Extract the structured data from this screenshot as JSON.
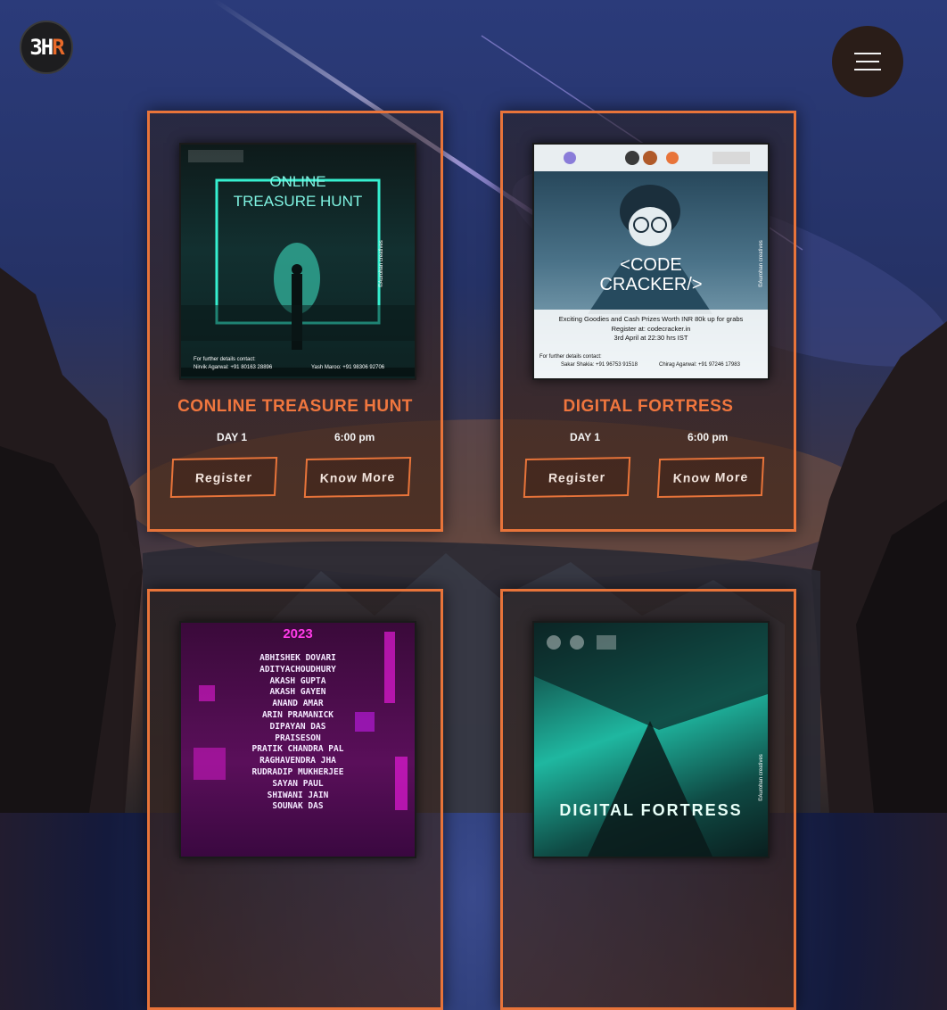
{
  "header": {
    "logo_text_a": "3H",
    "logo_text_b": "R"
  },
  "events": [
    {
      "title": "CONLINE TREASURE HUNT",
      "day": "DAY 1",
      "time": "6:00 pm",
      "register_label": "Register",
      "know_more_label": "Know More",
      "poster": {
        "line1": "ONLINE",
        "line2": "TREASURE HUNT",
        "contact_heading": "For further details contact:",
        "contact_a": "Nirvik Agarwal: +91 80163 28896",
        "contact_b": "Yash Maroo: +91 98306 92706",
        "credit": "©Aurohan creatives"
      }
    },
    {
      "title": "DIGITAL FORTRESS",
      "day": "DAY 1",
      "time": "6:00 pm",
      "register_label": "Register",
      "know_more_label": "Know More",
      "poster": {
        "line1": "<CODE",
        "line2": "CRACKER/>",
        "prize": "Exciting Goodies and Cash Prizes Worth INR 80k up for grabs",
        "register": "Register at: codecracker.in",
        "date": "3rd April at 22:30 hrs IST",
        "contact_heading": "For further details contact:",
        "contact_a": "Sakar Shakia: +91 96753 91518",
        "contact_b": "Chirag Agarwal: +91 97246 17983",
        "credit": "©Aurohan creatives"
      }
    },
    {
      "poster": {
        "year": "2023",
        "names": [
          "ABHISHEK DOVARI",
          "ADITYACHOUDHURY",
          "AKASH GUPTA",
          "AKASH GAYEN",
          "ANAND AMAR",
          "ARIN PRAMANICK",
          "DIPAYAN DAS",
          "PRAISESON",
          "PRATIK CHANDRA PAL",
          "RAGHAVENDRA JHA",
          "RUDRADIP MUKHERJEE",
          "SAYAN PAUL",
          "SHIWANI JAIN",
          "SOUNAK DAS"
        ]
      }
    },
    {
      "poster": {
        "title": "DIGITAL FORTRESS",
        "credit": "©Aurohan creatives"
      }
    }
  ],
  "colors": {
    "accent": "#e8743a",
    "title": "#f0763e"
  }
}
